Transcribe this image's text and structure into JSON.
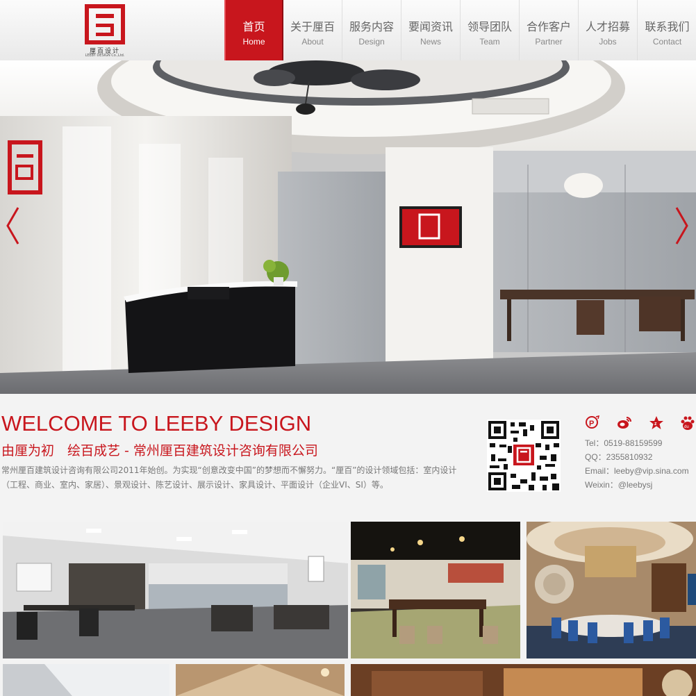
{
  "brand": {
    "name_cn": "厘百设计",
    "name_en": "LEEBY DESIGN Co.,Ltd.",
    "accent_color": "#c8161d"
  },
  "nav": [
    {
      "zh": "首页",
      "en": "Home",
      "active": true
    },
    {
      "zh": "关于厘百",
      "en": "About"
    },
    {
      "zh": "服务内容",
      "en": "Design"
    },
    {
      "zh": "要闻资讯",
      "en": "News"
    },
    {
      "zh": "领导团队",
      "en": "Team"
    },
    {
      "zh": "合作客户",
      "en": "Partner"
    },
    {
      "zh": "人才招募",
      "en": "Jobs"
    },
    {
      "zh": "联系我们",
      "en": "Contact"
    }
  ],
  "banner": {
    "prev_icon": "chevron-left-icon",
    "next_icon": "chevron-right-icon"
  },
  "welcome": {
    "title": "WELCOME TO LEEBY DESIGN",
    "subtitle": "由厘为初　绘百成艺 - 常州厘百建筑设计咨询有限公司",
    "description": "常州厘百建筑设计咨询有限公司2011年始创。为实现“创意改变中国”的梦想而不懈努力。“厘百”的设计领域包括：室内设计（工程、商业、室内、家居）、景观设计、陈艺设计、展示设计、家具设计、平面设计（企业VI、SI）等。"
  },
  "social": [
    "pinterest-icon",
    "weibo-icon",
    "qzone-icon",
    "baidu-icon"
  ],
  "contact": {
    "tel": "Tel：0519-88159599",
    "qq": "QQ：2355810932",
    "email": "Email：leeby@vip.sina.com",
    "weixin": "Weixin：@leebysj"
  }
}
